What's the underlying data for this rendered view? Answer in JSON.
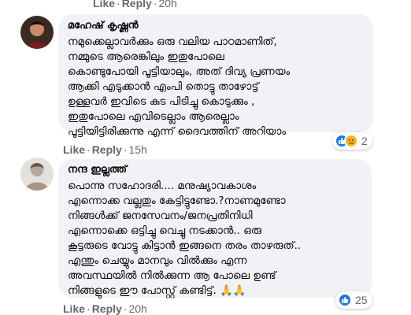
{
  "colors": {
    "action_text": "#65676b",
    "bubble_bg": "#f0f2f5",
    "like_blue": "#1877f2",
    "sad_yellow": "#f7b125"
  },
  "actions_top": {
    "like": "Like",
    "reply": "Reply",
    "time": "20h"
  },
  "comments": [
    {
      "author": "മഹേഷ് കൃഷ്ണൻ",
      "lines": [
        "നമുക്കെല്ലാവർക്കും ഒരു വലിയ പാഠമാണിത്,",
        "നമ്മുടെ ആരെങ്കിലും ഇതുപോലെ",
        "കൊണ്ടുപോയി പൂട്ടിയാലും, അത് ദിവ്യ പ്രണയം",
        "ആക്കി എടുക്കാൻ എംപി തൊട്ടു താഴോട്ട്",
        "ഉള്ളവർ ഇവിടെ കുട പിടിച്ചു കൊടുക്കും ,",
        "ഇതുപോലെ എവിടെല്ലാം ആരെല്ലാം",
        "പൂട്ടിയിട്ടിരിക്കുന്നു എന്ന് ദൈവത്തിന് അറിയാം"
      ],
      "actions": {
        "like": "Like",
        "reply": "Reply",
        "time": "15h"
      },
      "reactions": {
        "icons": [
          "like-icon",
          "sad-icon"
        ],
        "count": "2"
      }
    },
    {
      "author": "നന്ദ ഇല്ലത്ത്",
      "lines": [
        "പൊന്നു സഹോദരി.... മനുഷ്യാവകാശം",
        "എന്നൊക്ക വല്ലതും കേട്ടിട്ടുണ്ടോ.?നാണമുണ്ടോ",
        "നിങ്ങൾക്ക് ജനസേവനം/ജനപ്രതിനിധി",
        "എന്നൊക്കെ ഒട്ടിച്ചു വെച്ചു നടക്കാൻ.. ഒരു",
        "കൂട്ടരുടെ വോട്ടു കിട്ടാൻ ഇങ്ങനെ തരം താഴരുത്..",
        "എന്തും ചെയ്യും മാനവും വിൽക്കും എന്ന",
        "അവസ്ഥയിൽ നിൽക്കുന്ന ആ പോലെ ഉണ്ട്",
        "നിങ്ങളുടെ ഈ പോസ്റ്റ് കണ്ടിട്ട്. 🙏🙏"
      ],
      "actions": {
        "like": "Like",
        "reply": "Reply",
        "time": "20h"
      },
      "reactions": {
        "icons": [
          "like-icon"
        ],
        "count": "25"
      }
    }
  ]
}
